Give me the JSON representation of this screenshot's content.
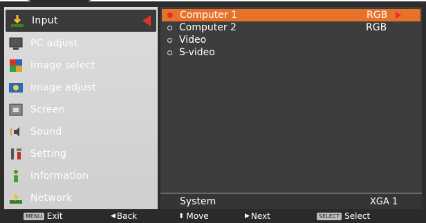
{
  "sidebar": {
    "items": [
      {
        "label": "Input",
        "icon": "input-icon",
        "active": true
      },
      {
        "label": "PC adjust",
        "icon": "monitor-icon"
      },
      {
        "label": "Image select",
        "icon": "image-select-icon"
      },
      {
        "label": "Image adjust",
        "icon": "image-adjust-icon"
      },
      {
        "label": "Screen",
        "icon": "screen-icon"
      },
      {
        "label": "Sound",
        "icon": "sound-icon"
      },
      {
        "label": "Setting",
        "icon": "setting-icon"
      },
      {
        "label": "Information",
        "icon": "information-icon"
      },
      {
        "label": "Network",
        "icon": "network-icon"
      }
    ]
  },
  "main": {
    "options": [
      {
        "name": "Computer 1",
        "value": "RGB",
        "selected": true
      },
      {
        "name": "Computer 2",
        "value": "RGB"
      },
      {
        "name": "Video",
        "value": ""
      },
      {
        "name": "S-video",
        "value": ""
      }
    ],
    "system": {
      "label": "System",
      "value": "XGA 1"
    }
  },
  "footer": {
    "menu_key": "MENU",
    "exit_label": "Exit",
    "back_label": "Back",
    "move_label": "Move",
    "next_label": "Next",
    "select_key": "SELECT",
    "select_label": "Select"
  },
  "colors": {
    "accent": "#e8722a",
    "marker": "#e03228"
  }
}
